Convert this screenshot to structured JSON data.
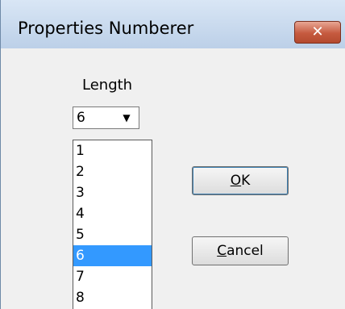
{
  "window": {
    "title": "Properties Numberer",
    "close_icon": "close-icon"
  },
  "length": {
    "label": "Length",
    "selected_value": "6",
    "dropdown_icon": "chevron-down-icon",
    "options": [
      "1",
      "2",
      "3",
      "4",
      "5",
      "6",
      "7",
      "8"
    ],
    "highlighted_option": "6"
  },
  "buttons": {
    "ok": {
      "mnemonic": "O",
      "rest": "K"
    },
    "cancel": {
      "mnemonic": "C",
      "rest": "ancel"
    }
  },
  "colors": {
    "selection": "#3399ff",
    "titlebar": "#c9daef",
    "close_button": "#c65a3f"
  }
}
